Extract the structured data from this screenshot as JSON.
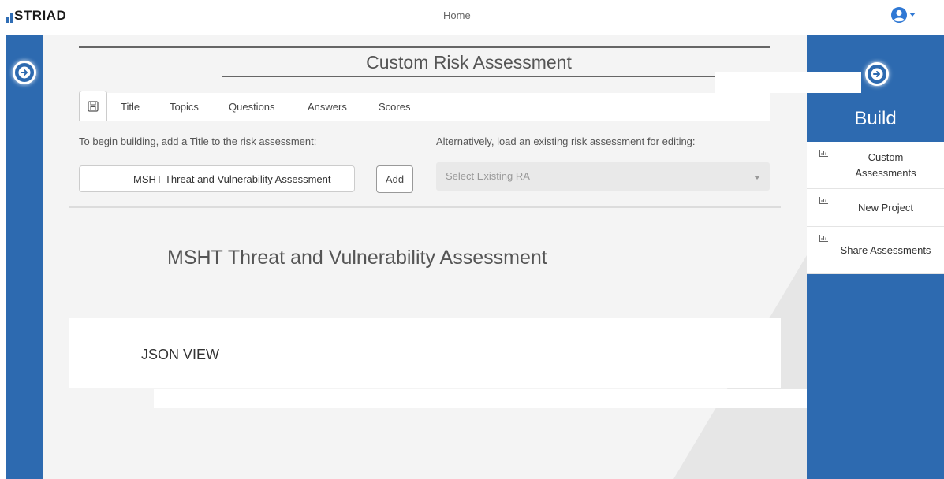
{
  "brand": {
    "name": "STRIAD"
  },
  "nav": {
    "home_label": "Home"
  },
  "user_menu": {
    "icon": "user-circle-icon",
    "caret": "caret-down-icon"
  },
  "page": {
    "title": "Custom Risk Assessment"
  },
  "tabs": [
    {
      "label": "Title",
      "active": true
    },
    {
      "label": "Topics"
    },
    {
      "label": "Questions"
    },
    {
      "label": "Answers"
    },
    {
      "label": "Scores"
    }
  ],
  "builder": {
    "title_hint": "To begin building, add a Title to the risk assessment:",
    "title_value": "MSHT Threat and Vulnerability Assessment",
    "add_label": "Add",
    "load_hint": "Alternatively, load an existing risk assessment for editing:",
    "select_placeholder": "Select Existing RA"
  },
  "assessment": {
    "heading": "MSHT Threat and Vulnerability Assessment",
    "json_view_label": "JSON VIEW"
  },
  "sidebar": {
    "title": "Build",
    "items": [
      {
        "label": "Custom Assessments",
        "icon": "bar-chart-icon"
      },
      {
        "label": "New Project",
        "icon": "bar-chart-icon"
      },
      {
        "label": "Share Assessments",
        "icon": "bar-chart-icon"
      }
    ]
  },
  "colors": {
    "accent": "#2d6ab0",
    "background": "#f4f4f4"
  }
}
